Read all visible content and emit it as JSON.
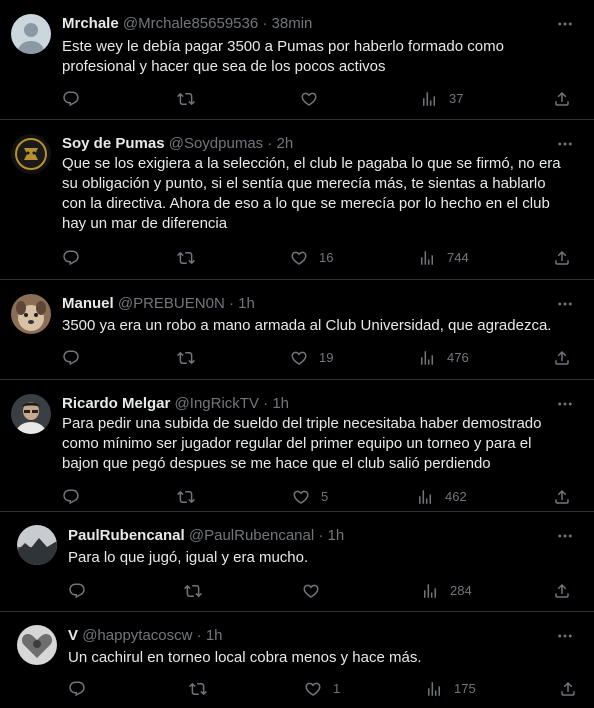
{
  "replies": [
    {
      "name": "Mrchale",
      "handle": "@Mrchale85659536",
      "time": "38min",
      "avatar": "default-avatar",
      "text": "Este wey le debía pagar 3500 a Pumas por haberlo formado como\nprofesional y hacer que sea de los pocos activos",
      "replies": "",
      "retweets": "",
      "likes": "",
      "views": "37"
    },
    {
      "name": "Soy de Pumas",
      "handle": "@Soydpumas",
      "time": "2h",
      "avatar": "pumas-logo-avatar",
      "text": "Que se los exigiera a la selección, el club le pagaba lo que se firmó, no era\nsu obligación y punto, si el sentía que merecía más, te sientas a hablarlo\ncon la directiva. Ahora de eso a lo que se merecía por lo hecho en el club\nhay un mar de diferencia",
      "replies": "",
      "retweets": "",
      "likes": "16",
      "views": "744"
    },
    {
      "name": "Manuel",
      "handle": "@PREBUEN0N",
      "time": "1h",
      "avatar": "dog-avatar",
      "text": "3500 ya era un robo a mano armada al Club Universidad, que agradezca.",
      "replies": "",
      "retweets": "",
      "likes": "19",
      "views": "476"
    },
    {
      "name": "Ricardo Melgar",
      "handle": "@IngRickTV",
      "time": "1h",
      "avatar": "person-avatar",
      "text": "Para pedir una subida de sueldo del triple necesitaba haber demostrado\ncomo mínimo ser jugador regular del primer equipo un torneo y para el\nbajon que pegó despues se me hace que el club salió perdiendo",
      "replies": "",
      "retweets": "",
      "likes": "5",
      "views": "462"
    },
    {
      "name": "PaulRubencanal",
      "handle": "@PaulRubencanal",
      "time": "1h",
      "avatar": "landscape-avatar",
      "text": "Para lo que jugó, igual y era mucho.",
      "replies": "",
      "retweets": "",
      "likes": "",
      "views": "284"
    },
    {
      "name": "V",
      "handle": "@happytacoscw",
      "time": "1h",
      "avatar": "heart-avatar",
      "text": "Un cachirul en torneo local cobra menos y hace más.",
      "replies": "",
      "retweets": "",
      "likes": "1",
      "views": "175"
    }
  ],
  "separator": "·",
  "colors": {
    "background": "#000000",
    "text": "#e7e9ea",
    "secondary": "#71767b",
    "divider": "#2f3336"
  }
}
